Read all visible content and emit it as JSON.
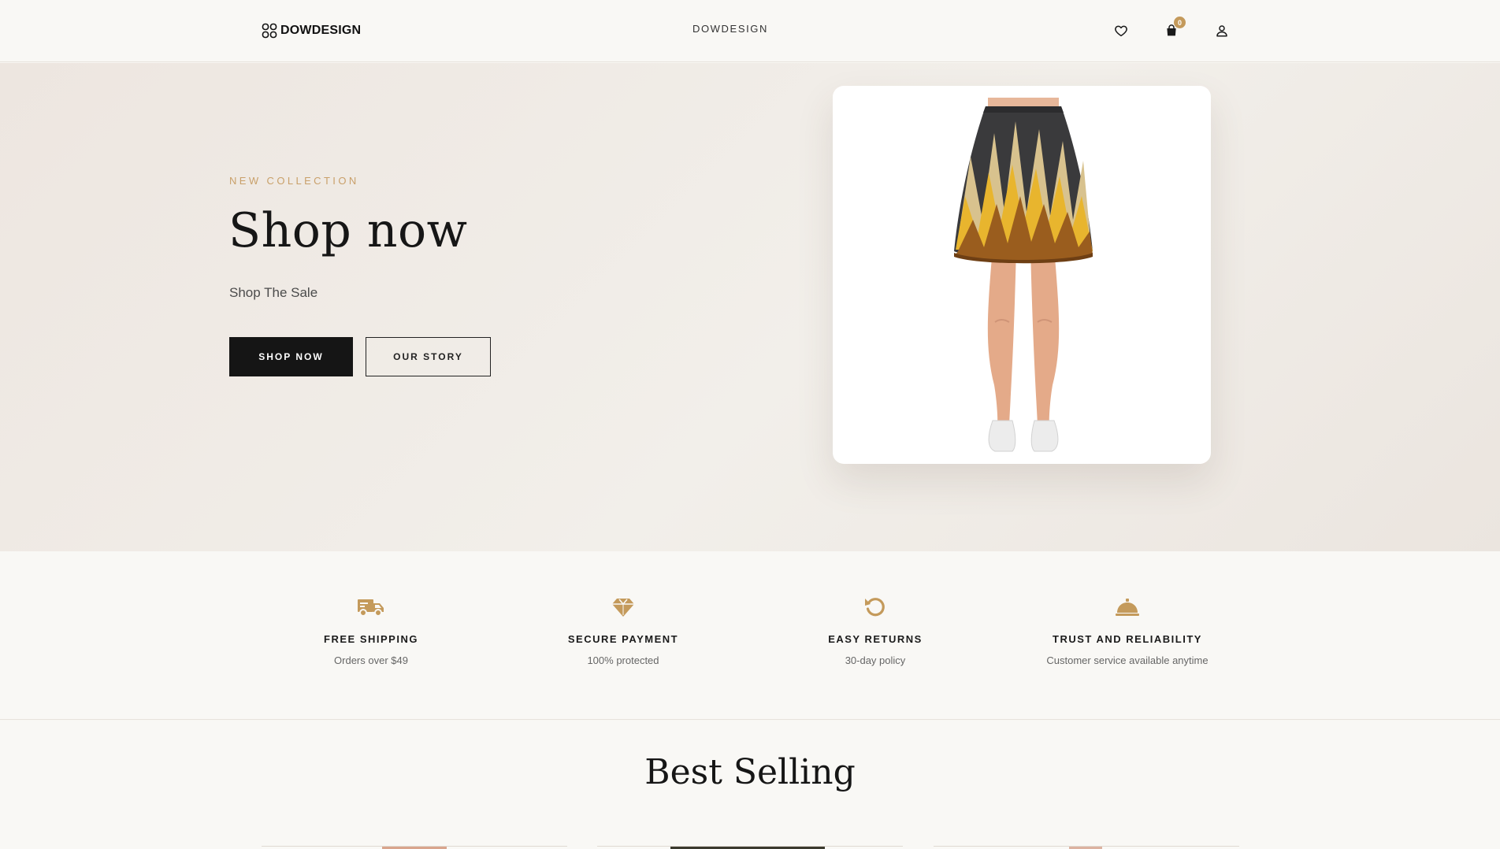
{
  "header": {
    "logo_text": "DOWDESIGN",
    "nav_center": "DOWDESIGN",
    "cart_count": "0",
    "icons": [
      "heart-icon",
      "shopping-bag-icon",
      "user-icon"
    ]
  },
  "hero": {
    "eyebrow": "NEW COLLECTION",
    "title": "Shop now",
    "subtitle": "Shop The Sale",
    "primary_button": "SHOP NOW",
    "secondary_button": "OUR STORY"
  },
  "features": [
    {
      "icon": "truck-icon",
      "title": "FREE SHIPPING",
      "desc": "Orders over $49"
    },
    {
      "icon": "diamond-icon",
      "title": "SECURE PAYMENT",
      "desc": "100% protected"
    },
    {
      "icon": "return-icon",
      "title": "EASY RETURNS",
      "desc": "30-day policy"
    },
    {
      "icon": "service-bell-icon",
      "title": "TRUST AND RELIABILITY",
      "desc": "Customer service available anytime"
    }
  ],
  "best_selling": {
    "title": "Best Selling"
  },
  "colors": {
    "accent": "#c49a5b",
    "eyebrow": "#c9a06a",
    "primary_button_bg": "#151515",
    "hero_bg": "#ede6e0",
    "page_bg": "#f9f8f5"
  }
}
